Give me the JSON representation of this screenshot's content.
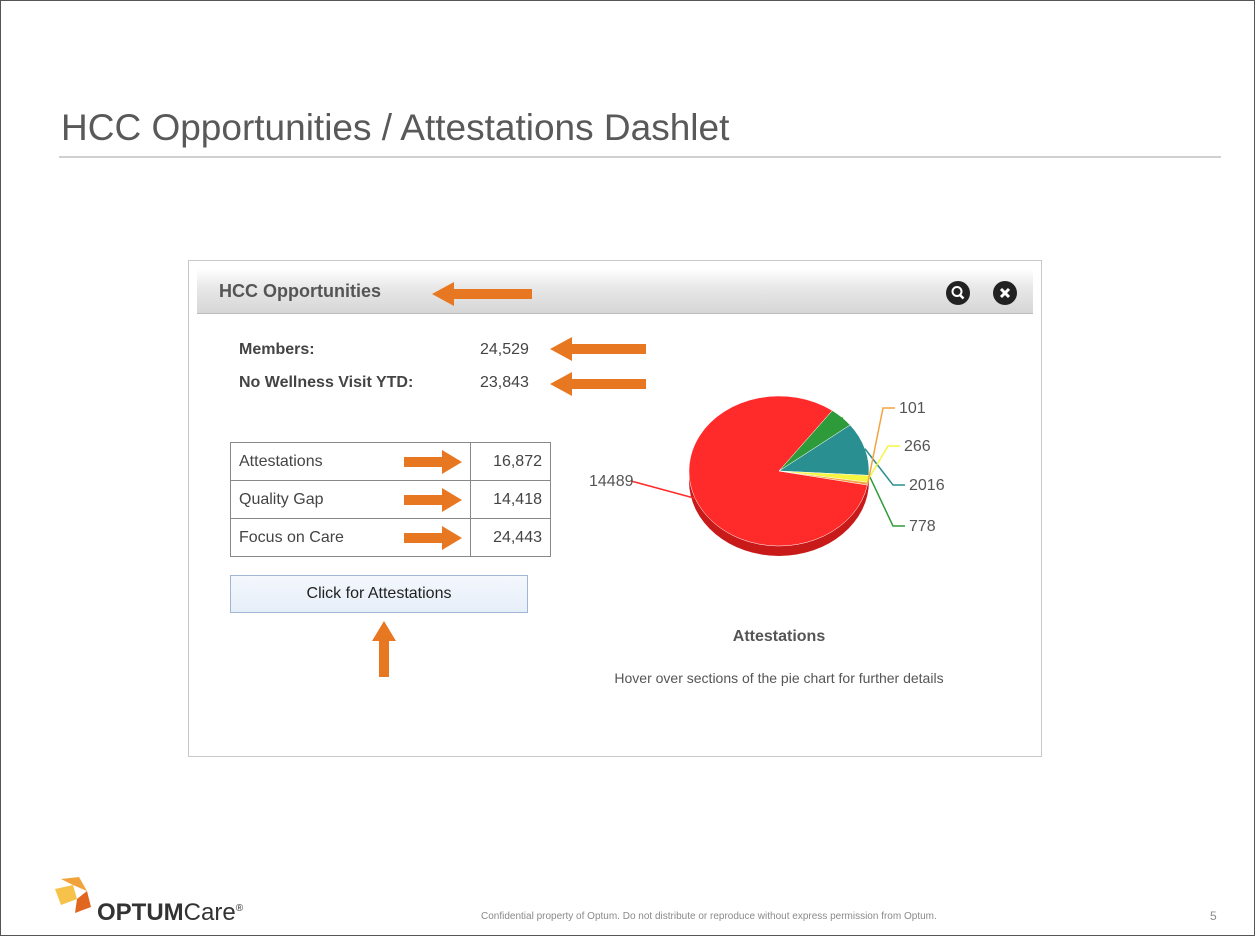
{
  "slide": {
    "title": "HCC Opportunities / Attestations Dashlet",
    "page_number": "5",
    "footer_note": "Confidential property of Optum. Do not distribute or reproduce without express permission from Optum."
  },
  "logo": {
    "brand": "OPTUM",
    "suffix": "Care",
    "mark": "®"
  },
  "dashlet": {
    "title": "HCC Opportunities",
    "icons": [
      "search-icon",
      "close-icon"
    ],
    "members_label": "Members:",
    "members_value": "24,529",
    "no_wellness_label": "No Wellness Visit YTD:",
    "no_wellness_value": "23,843",
    "table": [
      {
        "label": "Attestations",
        "value": "16,872"
      },
      {
        "label": "Quality Gap",
        "value": "14,418"
      },
      {
        "label": "Focus on Care",
        "value": "24,443"
      }
    ],
    "button_label": "Click for Attestations",
    "annotation_color": "#e87722"
  },
  "chart_data": {
    "type": "pie",
    "title": "Attestations",
    "note": "Hover over sections of the pie chart for further details",
    "slices": [
      {
        "label": "14489",
        "value": 14489,
        "color": "#ff2a2a"
      },
      {
        "label": "778",
        "value": 778,
        "color": "#2e9b3a"
      },
      {
        "label": "2016",
        "value": 2016,
        "color": "#2a8f91"
      },
      {
        "label": "266",
        "value": 266,
        "color": "#f5f542"
      },
      {
        "label": "101",
        "value": 101,
        "color": "#f4a340"
      }
    ]
  }
}
